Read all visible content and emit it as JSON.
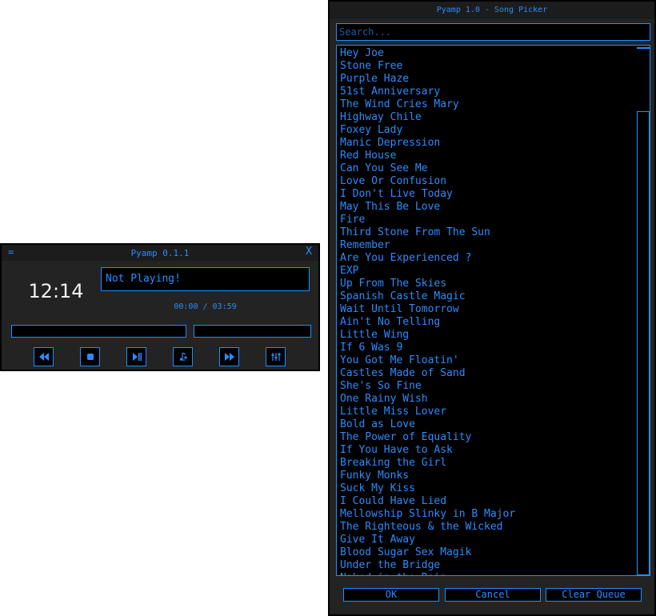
{
  "player": {
    "menu_glyph": "=",
    "title": "Pyamp 0.1.1",
    "close_label": "X",
    "clock": "12:14",
    "status": "Not Playing!",
    "time_display": "00:00 / 03:59",
    "progress_fraction": 0,
    "volume_fraction": 0,
    "accent_color": "#1e90ff",
    "controls": [
      {
        "name": "rewind-icon"
      },
      {
        "name": "stop-icon"
      },
      {
        "name": "play-pause-icon"
      },
      {
        "name": "playlist-icon"
      },
      {
        "name": "fast-forward-icon"
      },
      {
        "name": "equalizer-icon"
      }
    ]
  },
  "picker": {
    "title": "Pyamp 1.0 - Song Picker",
    "search_placeholder": "Search...",
    "songs": [
      "Hey Joe",
      "Stone Free",
      "Purple Haze",
      "51st Anniversary",
      "The Wind Cries Mary",
      "Highway Chile",
      "Foxey Lady",
      "Manic Depression",
      "Red House",
      "Can You See Me",
      "Love Or Confusion",
      "I Don't Live Today",
      "May This Be Love",
      "Fire",
      "Third Stone From The Sun",
      "Remember",
      "Are You Experienced ?",
      "EXP",
      "Up From The Skies",
      "Spanish Castle Magic",
      "Wait Until Tomorrow",
      "Ain't No Telling",
      "Little Wing",
      "If 6 Was 9",
      "You Got Me Floatin'",
      "Castles Made of Sand",
      "She's So Fine",
      "One Rainy Wish",
      "Little Miss Lover",
      "Bold as Love",
      "The Power of Equality",
      "If You Have to Ask",
      "Breaking the Girl",
      "Funky Monks",
      "Suck My Kiss",
      "I Could Have Lied",
      "Mellowship Slinky in B Major",
      "The Righteous & the Wicked",
      "Give It Away",
      "Blood Sugar Sex Magik",
      "Under the Bridge",
      "Naked in the Rain"
    ],
    "buttons": {
      "ok": "OK",
      "cancel": "Cancel",
      "clear": "Clear Queue"
    }
  }
}
